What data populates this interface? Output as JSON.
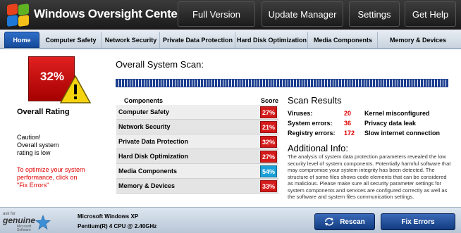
{
  "header": {
    "title": "Windows Oversight Center",
    "buttons": [
      "Full Version",
      "Update Manager",
      "Settings",
      "Get Help"
    ]
  },
  "tabs": [
    "Home",
    "Computer Safety",
    "Network Security",
    "Private Data Protection",
    "Hard Disk Optimization",
    "Media Components",
    "Memory & Devices"
  ],
  "active_tab": "Home",
  "left_panel": {
    "rating": "32%",
    "overall_rating": "Overall Rating",
    "caution": "Caution!\nOverall system\nrating is low",
    "fix_hint": "To optimize your system\nperformance, click on\n\"Fix Errors\""
  },
  "scan": {
    "title": "Overall System Scan:",
    "progress": 1.0
  },
  "components": {
    "header_name": "Components",
    "header_score": "Score",
    "rows": [
      {
        "name": "Computer Safety",
        "score": "27%",
        "status": "bad"
      },
      {
        "name": "Network Security",
        "score": "21%",
        "status": "bad"
      },
      {
        "name": "Private Data Protection",
        "score": "32%",
        "status": "bad"
      },
      {
        "name": "Hard Disk Optimization",
        "score": "27%",
        "status": "bad"
      },
      {
        "name": "Media Components",
        "score": "54%",
        "status": "ok"
      },
      {
        "name": "Memory & Devices",
        "score": "33%",
        "status": "bad"
      }
    ]
  },
  "results": {
    "title": "Scan Results",
    "rows": [
      {
        "label": "Viruses:",
        "value": "20",
        "desc": "Kernel misconfigured"
      },
      {
        "label": "System errors:",
        "value": "36",
        "desc": "Privacy data leak"
      },
      {
        "label": "Registry errors:",
        "value": "172",
        "desc": "Slow internet connection"
      }
    ]
  },
  "info": {
    "title": "Additional Info:",
    "text": "The analysis of system data protection parameters revealed the low security level of system components. Potentially harmful software that may compromise your system integrity has been detected. The structure of some files shows code elements that can be considered as malicious. Please make sure all security parameter settings for system components and services are configured correctly as well as the software and system files communication settings."
  },
  "footer": {
    "genuine_ask": "ask for",
    "genuine_word": "genuine",
    "genuine_ms": "Microsoft\nSoftware",
    "os": "Microsoft Windows XP",
    "cpu": "Pentium(R) 4 CPU @ 2.40GHz",
    "rescan_label": "Rescan",
    "fix_label": "Fix Errors"
  },
  "colors": {
    "bad": "#d41a1a",
    "ok": "#1aa0d8",
    "progress": "#1d3f8f",
    "accent_red": "#e00000"
  }
}
